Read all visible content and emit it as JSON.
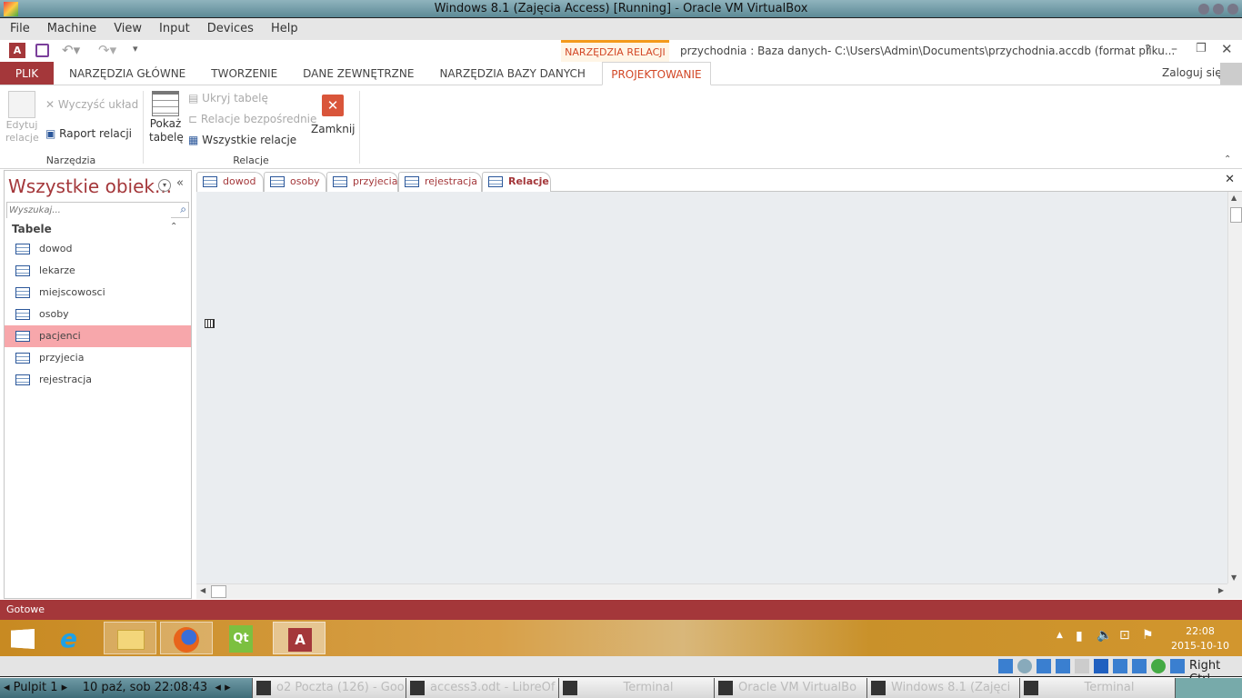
{
  "vbox": {
    "title": "Windows 8.1 (Zajęcia Access) [Running] - Oracle VM VirtualBox",
    "menu": [
      "File",
      "Machine",
      "View",
      "Input",
      "Devices",
      "Help"
    ],
    "host_key": "Right Ctrl"
  },
  "access": {
    "context_tab": "NARZĘDZIA RELACJI",
    "doc_title": "przychodnia : Baza danych- C:\\Users\\Admin\\Documents\\przychodnia.accdb (format pliku...",
    "help": "?",
    "signin": "Zaloguj się",
    "tabs": [
      "PLIK",
      "NARZĘDZIA GŁÓWNE",
      "TWORZENIE",
      "DANE ZEWNĘTRZNE",
      "NARZĘDZIA BAZY DANYCH",
      "PROJEKTOWANIE"
    ],
    "ribbon": {
      "edit_relations": [
        "Edytuj",
        "relacje"
      ],
      "clear_layout": "Wyczyść układ",
      "relation_report": "Raport relacji",
      "group_tools": "Narzędzia",
      "show_table": [
        "Pokaż",
        "tabelę"
      ],
      "hide_table": "Ukryj tabelę",
      "direct_relations": "Relacje bezpośrednie",
      "all_relations": "Wszystkie relacje",
      "close": "Zamknij",
      "group_relations": "Relacje"
    },
    "nav": {
      "title": "Wszystkie obiek...",
      "search_placeholder": "Wyszukaj...",
      "section": "Tabele",
      "items": [
        "dowod",
        "lekarze",
        "miejscowosci",
        "osoby",
        "pacjenci",
        "przyjecia",
        "rejestracja"
      ],
      "selected": "pacjenci"
    },
    "doc_tabs": [
      "dowod",
      "osoby",
      "przyjecia",
      "rejestracja",
      "Relacje"
    ],
    "active_doc_tab": "Relacje",
    "status": "Gotowe",
    "accent": "#a4373a"
  },
  "windows_taskbar": {
    "time": "22:08",
    "date": "2015-10-10",
    "apps": [
      "start-icon",
      "ie-icon",
      "explorer-icon",
      "firefox-icon",
      "qt-icon",
      "access-icon"
    ]
  },
  "linux_taskbar": {
    "desktop": "Pulpit 1",
    "clock": "10 paź, sob 22:08:43",
    "tasks": [
      "o2 Poczta (126) - Goo",
      "access3.odt - LibreOf",
      "Terminal",
      "Oracle VM VirtualBo",
      "Windows 8.1 (Zajęci",
      "Terminal"
    ]
  }
}
